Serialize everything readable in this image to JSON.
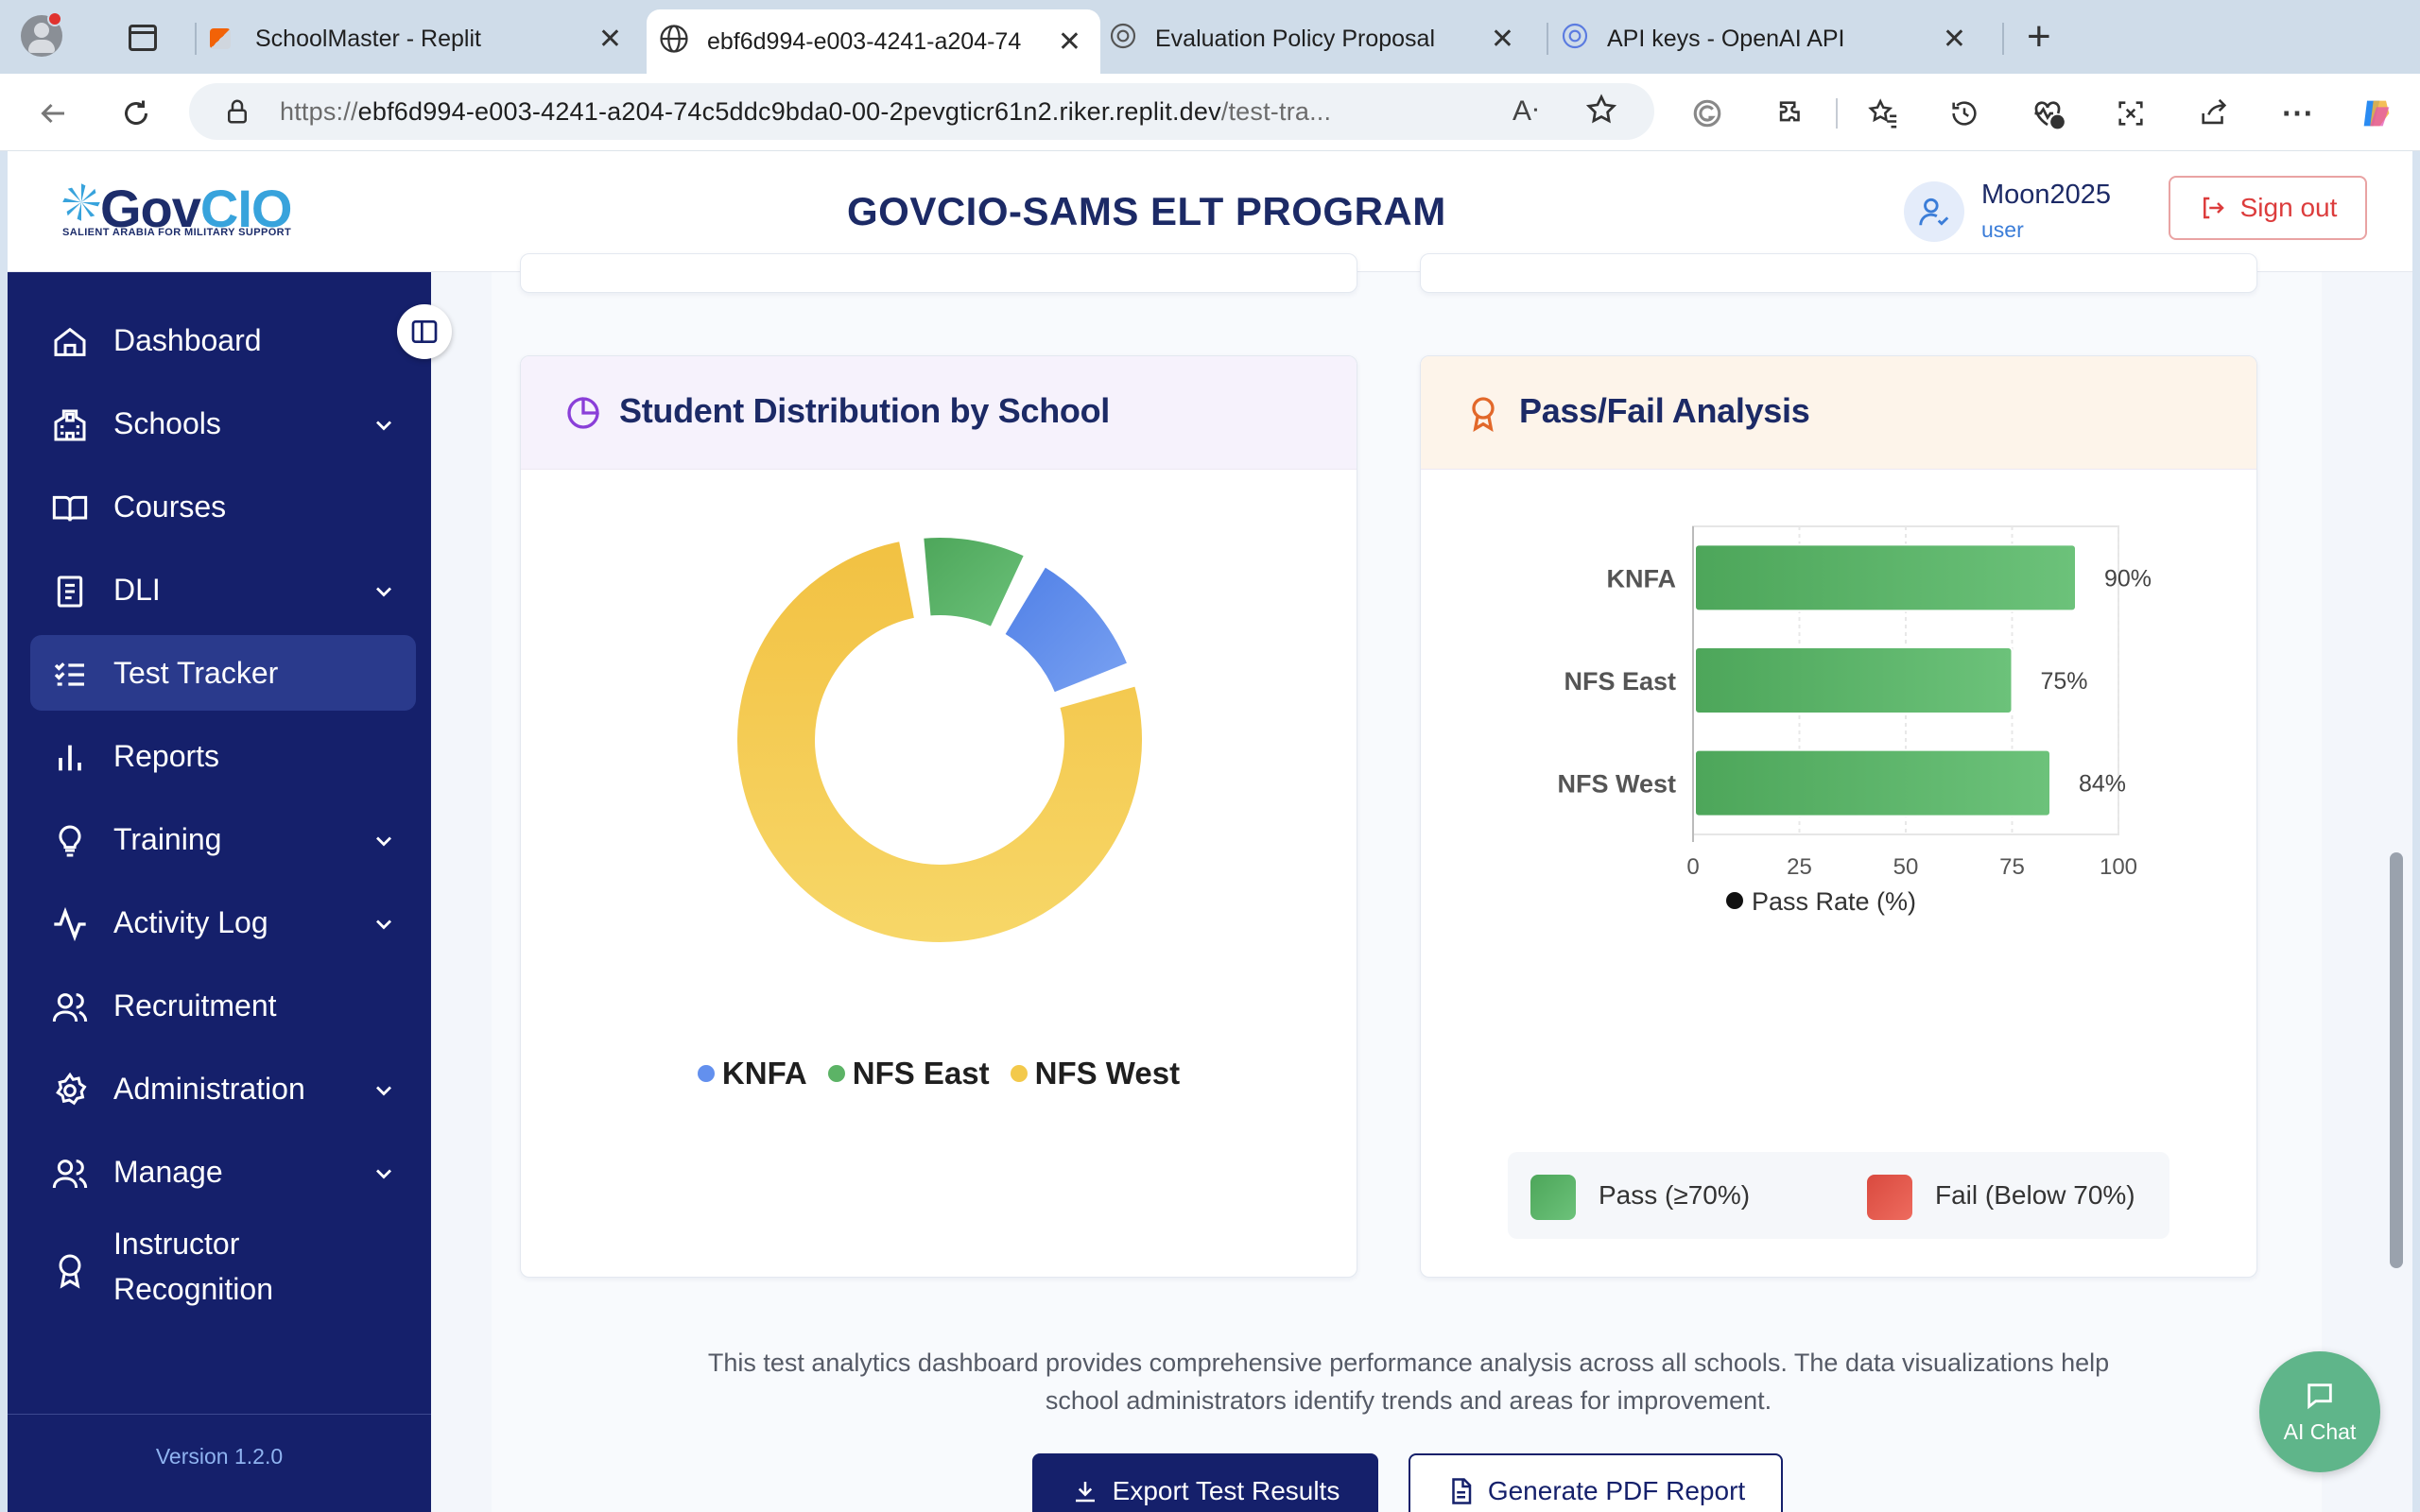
{
  "browser": {
    "tabs": [
      {
        "title": "SchoolMaster - Replit",
        "close": "✕"
      },
      {
        "title": "ebf6d994-e003-4241-a204-74",
        "close": "✕"
      },
      {
        "title": "Evaluation Policy Proposal",
        "close": "✕"
      },
      {
        "title": "API keys - OpenAI API",
        "close": "✕"
      }
    ],
    "new_tab": "+",
    "url_prefix": "https://",
    "url_host": "ebf6d994-e003-4241-a204-74c5ddc9bda0-00-2pevgticr61n2.riker.replit.dev",
    "url_path": "/test-tra..."
  },
  "header": {
    "logo_main": "Gov",
    "logo_accent": "CIO",
    "logo_sub": "SALIENT ARABIA FOR MILITARY SUPPORT",
    "program_title": "GOVCIO-SAMS ELT PROGRAM",
    "user_name": "Moon2025",
    "user_role": "user",
    "signout_label": "Sign out"
  },
  "sidebar": {
    "items": [
      {
        "label": "Dashboard",
        "icon": "home-icon"
      },
      {
        "label": "Schools",
        "icon": "school-icon",
        "expandable": true
      },
      {
        "label": "Courses",
        "icon": "book-open-icon"
      },
      {
        "label": "DLI",
        "icon": "notebook-icon",
        "expandable": true
      },
      {
        "label": "Test Tracker",
        "icon": "checklist-icon",
        "active": true
      },
      {
        "label": "Reports",
        "icon": "bar-chart-icon"
      },
      {
        "label": "Training",
        "icon": "lightbulb-icon",
        "expandable": true
      },
      {
        "label": "Activity Log",
        "icon": "activity-icon",
        "expandable": true
      },
      {
        "label": "Recruitment",
        "icon": "users-icon"
      },
      {
        "label": "Administration",
        "icon": "gear-icon",
        "expandable": true
      },
      {
        "label": "Manage",
        "icon": "users-icon",
        "expandable": true
      },
      {
        "label": "Instructor",
        "label2": "Recognition",
        "icon": "award-icon"
      }
    ],
    "version": "Version 1.2.0"
  },
  "distribution_card": {
    "title": "Student Distribution by School",
    "legend": [
      {
        "label": "KNFA",
        "color": "#6390ee"
      },
      {
        "label": "NFS East",
        "color": "#5cb366"
      },
      {
        "label": "NFS West",
        "color": "#f3c94b"
      }
    ]
  },
  "passfail_card": {
    "title": "Pass/Fail Analysis",
    "series_label": "Pass Rate (%)",
    "legend_pass": "Pass (≥70%)",
    "legend_fail": "Fail (Below 70%)",
    "pass_color": "#5cb366",
    "fail_color": "#e5574b"
  },
  "chart_data": [
    {
      "type": "pie",
      "variant": "doughnut",
      "categories": [
        "KNFA",
        "NFS East",
        "NFS West"
      ],
      "values": [
        12,
        10,
        78
      ],
      "colors": [
        "#6390ee",
        "#5cb366",
        "#f3c94b"
      ],
      "legend": "bottom"
    },
    {
      "type": "bar",
      "orientation": "horizontal",
      "categories": [
        "KNFA",
        "NFS East",
        "NFS West"
      ],
      "series": [
        {
          "name": "Pass Rate (%)",
          "values": [
            90,
            75,
            84
          ]
        }
      ],
      "data_labels": [
        "90%",
        "75%",
        "84%"
      ],
      "xlim": [
        0,
        100
      ],
      "xticks": [
        0,
        25,
        50,
        75,
        100
      ],
      "grid": true,
      "legend": "bottom"
    }
  ],
  "footer": {
    "note": "This test analytics dashboard provides comprehensive performance analysis across all schools. The data visualizations help school administrators identify trends and areas for improvement.",
    "export_label": "Export Test Results",
    "pdf_label": "Generate PDF Report"
  },
  "ai_chat_label": "AI Chat"
}
